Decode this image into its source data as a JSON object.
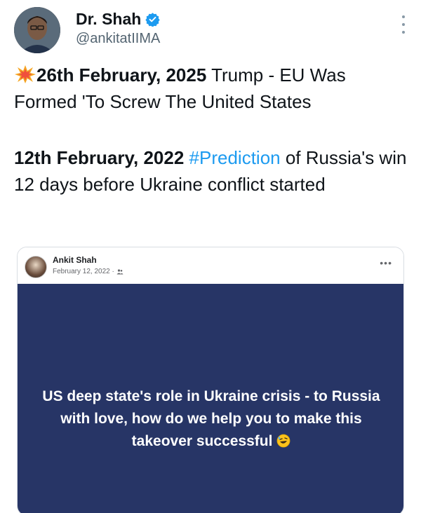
{
  "tweet": {
    "author": {
      "display_name": "Dr. Shah",
      "handle": "@ankitatIIMA",
      "verified_icon": "verified-badge-icon",
      "verified_color": "#1d9bf0"
    },
    "more_icon": "more-vertical-icon",
    "paragraph1": {
      "emoji": "collision-emoji",
      "bold_text": "26th February, 2025",
      "text": " Trump - EU Was Formed 'To Screw The United States"
    },
    "paragraph2": {
      "bold_text": "12th February, 2022",
      "hashtag": "#Prediction",
      "text": " of Russia's win 12 days before Ukraine conflict started"
    }
  },
  "embedded_post": {
    "author_name": "Ankit Shah",
    "date": "February 12, 2022 ·",
    "audience_icon": "friends-icon",
    "more_label": "•••",
    "body_text": "US deep state's role in Ukraine crisis - to Russia with love, how do we help you to make this takeover successful",
    "body_emoji": "rolling-on-floor-laughing-emoji",
    "body_bg": "#273566"
  }
}
